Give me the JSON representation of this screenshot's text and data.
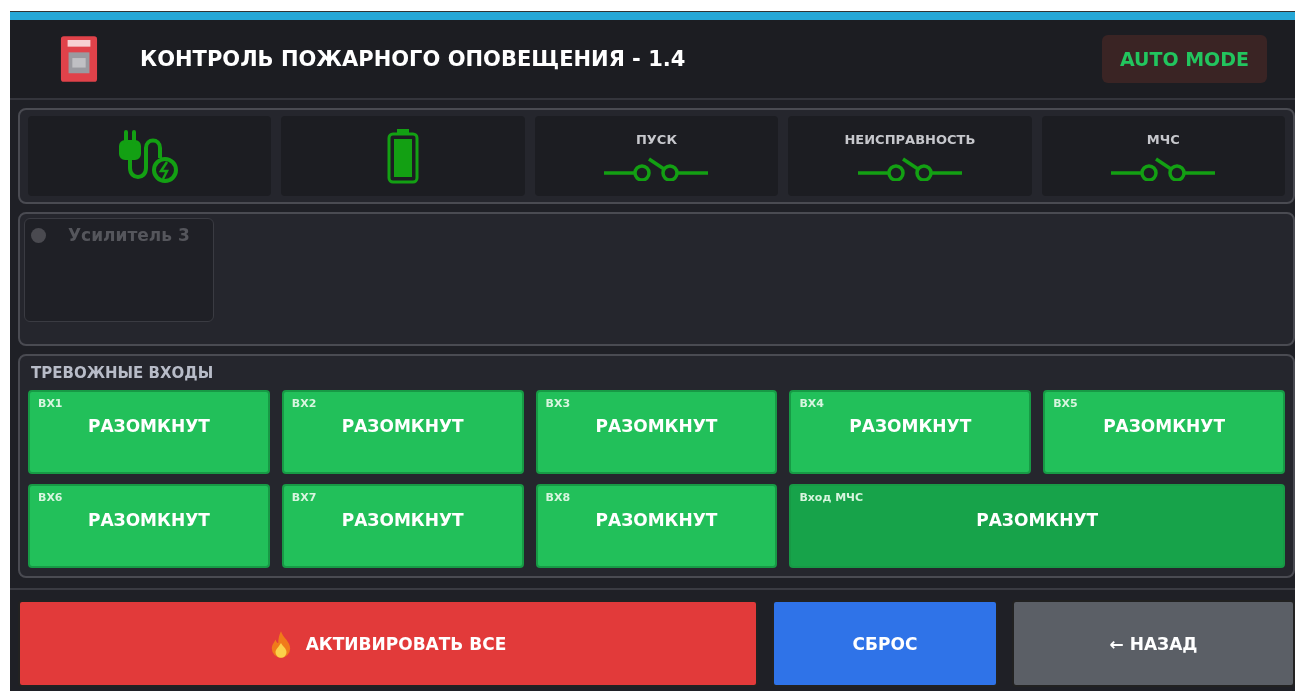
{
  "header": {
    "title": "КОНТРОЛЬ ПОЖАРНОГО ОПОВЕЩЕНИЯ - 1.4",
    "mode": "AUTO MODE"
  },
  "status_tiles": [
    {
      "kind": "power"
    },
    {
      "kind": "battery"
    },
    {
      "kind": "switch",
      "label": "ПУСК"
    },
    {
      "kind": "switch",
      "label": "НЕИСПРАВНОСТЬ"
    },
    {
      "kind": "switch",
      "label": "МЧС"
    }
  ],
  "amplifiers": [
    {
      "name": "Усилитель 3",
      "active": false
    }
  ],
  "alarm_inputs": {
    "title": "ТРЕВОЖНЫЕ ВХОДЫ",
    "items": [
      {
        "label": "ВХ1",
        "state": "РАЗОМКНУТ",
        "wide": false
      },
      {
        "label": "ВХ2",
        "state": "РАЗОМКНУТ",
        "wide": false
      },
      {
        "label": "ВХ3",
        "state": "РАЗОМКНУТ",
        "wide": false
      },
      {
        "label": "ВХ4",
        "state": "РАЗОМКНУТ",
        "wide": false
      },
      {
        "label": "ВХ5",
        "state": "РАЗОМКНУТ",
        "wide": false
      },
      {
        "label": "ВХ6",
        "state": "РАЗОМКНУТ",
        "wide": false
      },
      {
        "label": "ВХ7",
        "state": "РАЗОМКНУТ",
        "wide": false
      },
      {
        "label": "ВХ8",
        "state": "РАЗОМКНУТ",
        "wide": false
      },
      {
        "label": "Вход МЧС",
        "state": "РАЗОМКНУТ",
        "wide": true
      }
    ]
  },
  "buttons": [
    {
      "kind": "activate",
      "label": "АКТИВИРОВАТЬ ВСЕ"
    },
    {
      "kind": "reset",
      "label": "СБРОС"
    },
    {
      "kind": "back",
      "label": "← НАЗАД"
    }
  ]
}
